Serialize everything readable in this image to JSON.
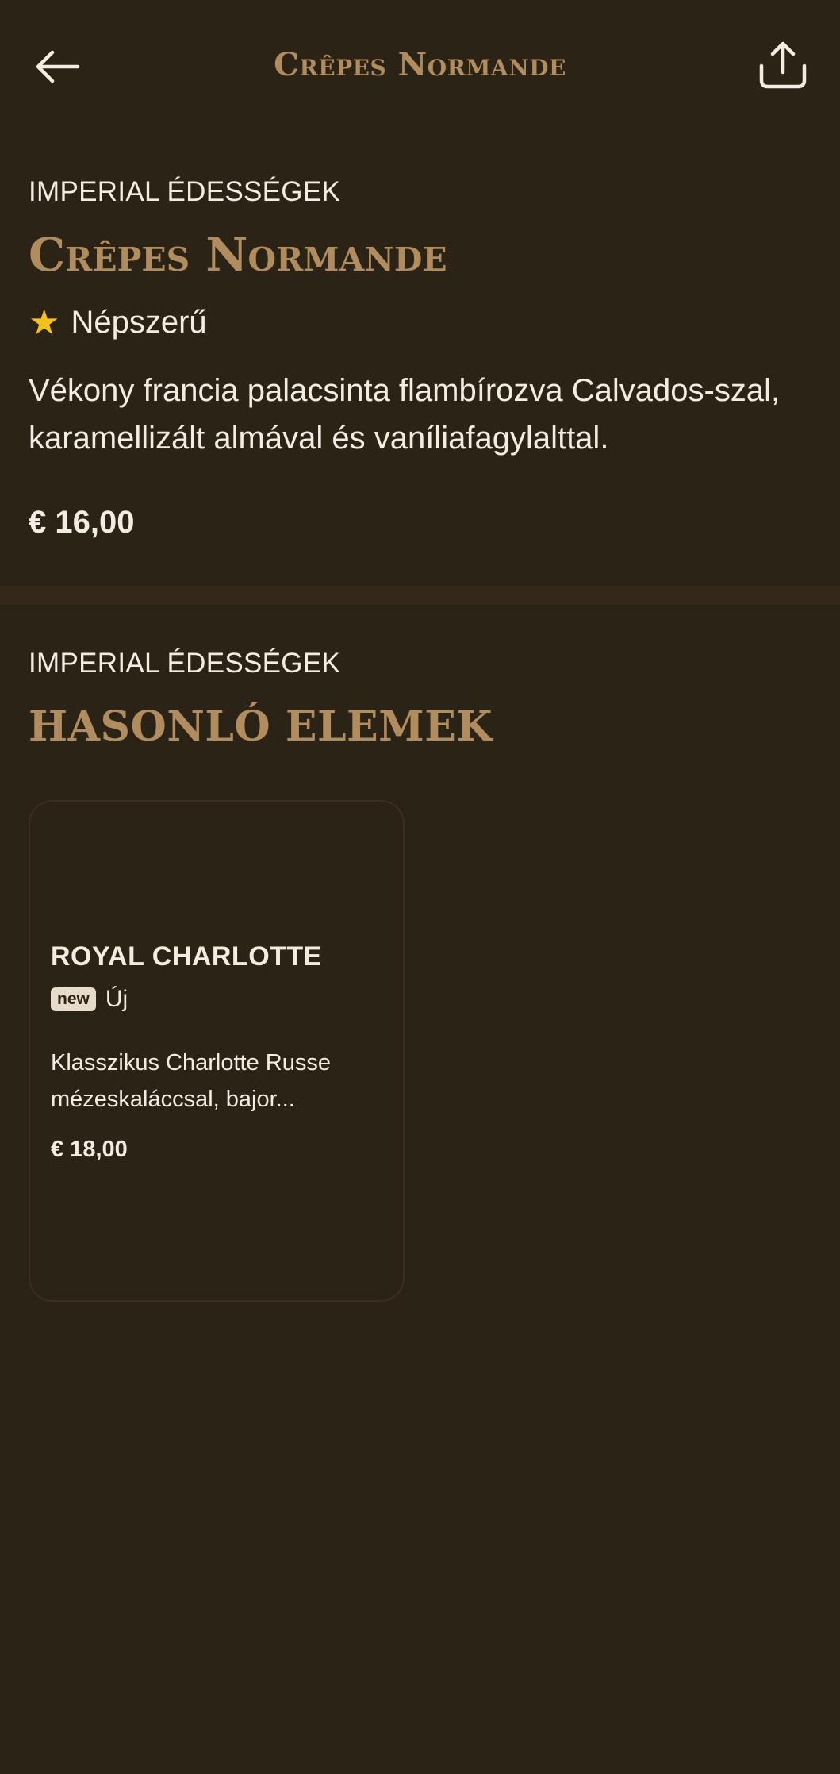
{
  "header": {
    "title": "Crêpes Normande",
    "back_icon": "arrow-left-icon",
    "share_icon": "share-icon"
  },
  "dish": {
    "category": "IMPERIAL ÉDESSÉGEK",
    "title": "Crêpes Normande",
    "tag_icon": "star-icon",
    "tag_label": "Népszerű",
    "description": "Vékony francia palacsinta flambírozva Calvados-szal, karamellizált almával és vaníliafagylalttal.",
    "price": "€ 16,00"
  },
  "similar": {
    "category": "IMPERIAL ÉDESSÉGEK",
    "heading": "HASONLÓ ELEMEK",
    "items": [
      {
        "title": "ROYAL CHARLOTTE",
        "badge": "new",
        "tag_label": "Új",
        "description": "Klasszikus Charlotte Russe mézeskaláccsal, bajor...",
        "price": "€ 18,00"
      }
    ]
  },
  "colors": {
    "background": "#2c2317",
    "accent_gold": "#b08c5e",
    "text": "#f3ece3",
    "star": "#f4c01e"
  }
}
